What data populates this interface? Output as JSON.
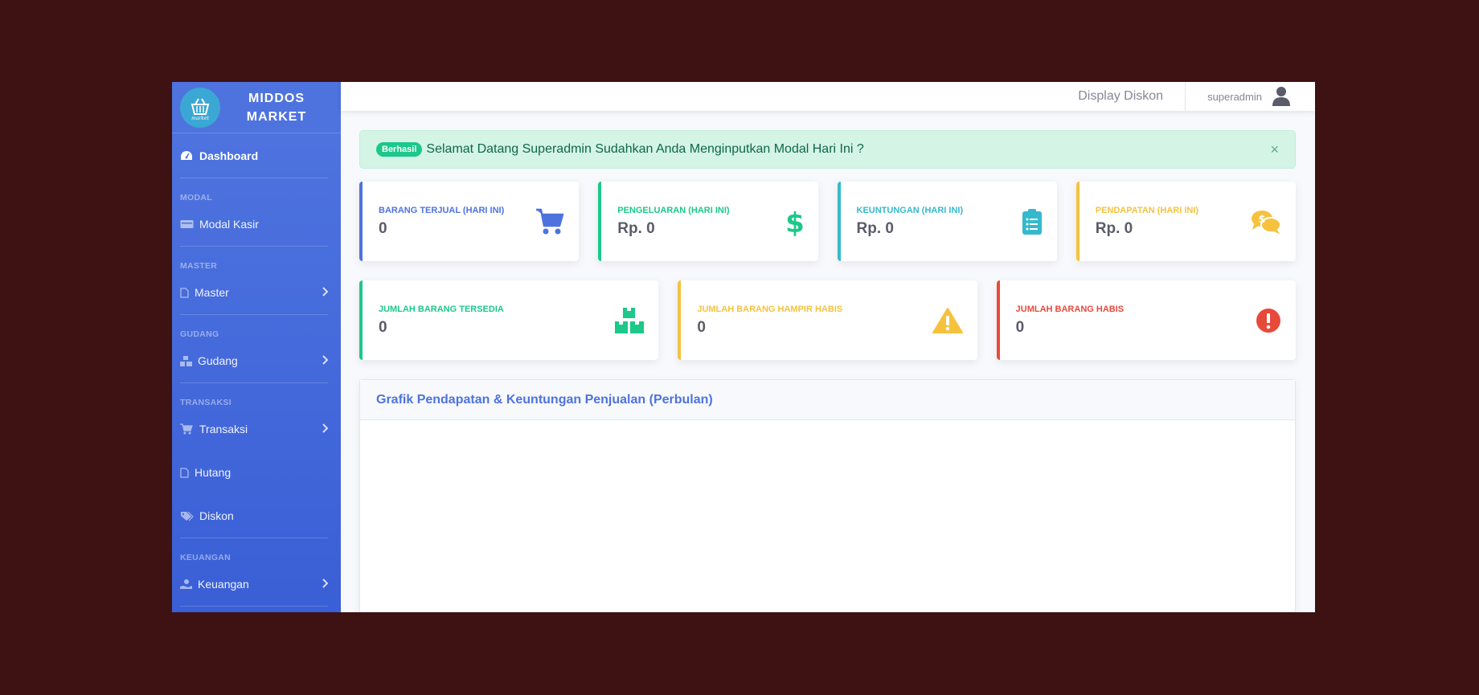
{
  "brand": {
    "name_line1": "MIDDOS",
    "name_line2": "MARKET",
    "logo_text": "market"
  },
  "sidebar": {
    "dashboard": "Dashboard",
    "headings": {
      "modal": "MODAL",
      "master": "MASTER",
      "gudang": "GUDANG",
      "transaksi": "TRANSAKSI",
      "keuangan": "KEUANGAN"
    },
    "items": {
      "modal_kasir": "Modal Kasir",
      "master": "Master",
      "gudang": "Gudang",
      "transaksi": "Transaksi",
      "hutang": "Hutang",
      "diskon": "Diskon",
      "keuangan": "Keuangan"
    }
  },
  "topbar": {
    "display_diskon": "Display Diskon",
    "username": "superadmin"
  },
  "alert": {
    "badge": "Berhasil",
    "message": "Selamat Datang Superadmin Sudahkan Anda Menginputkan Modal Hari Ini ?",
    "close": "×"
  },
  "stats_row1": [
    {
      "label": "BARANG TERJUAL (HARI INI)",
      "value": "0",
      "color": "#4e73df",
      "icon": "cart-icon"
    },
    {
      "label": "PENGELUARAN (HARI INI)",
      "value": "Rp. 0",
      "color": "#1cc88a",
      "icon": "dollar-icon"
    },
    {
      "label": "KEUNTUNGAN (HARI INI)",
      "value": "Rp. 0",
      "color": "#36b9cc",
      "icon": "clipboard-icon"
    },
    {
      "label": "PENDAPATAN (HARI INI)",
      "value": "Rp. 0",
      "color": "#f6c23e",
      "icon": "comments-dollar-icon"
    }
  ],
  "stats_row2": [
    {
      "label": "JUMLAH BARANG TERSEDIA",
      "value": "0",
      "color": "#1cc88a",
      "icon": "boxes-icon"
    },
    {
      "label": "JUMLAH BARANG HAMPIR HABIS",
      "value": "0",
      "color": "#f6c23e",
      "icon": "warning-icon"
    },
    {
      "label": "JUMLAH BARANG HABIS",
      "value": "0",
      "color": "#e74a3b",
      "icon": "exclamation-circle-icon"
    }
  ],
  "chart": {
    "title": "Grafik Pendapatan & Keuntungan Penjualan (Perbulan)"
  }
}
